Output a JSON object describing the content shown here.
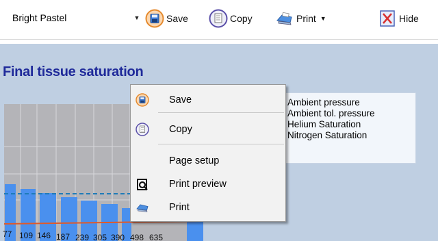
{
  "toolbar": {
    "theme_select": {
      "value": "Bright Pastel"
    },
    "save_label": "Save",
    "copy_label": "Copy",
    "print_label": "Print",
    "hide_label": "Hide"
  },
  "icons": {
    "combo_dropdown": "chevron-down-icon",
    "save": "floppy-disk-icon",
    "copy": "copy-document-icon",
    "print": "printer-icon",
    "print_dropdown": "chevron-down-icon",
    "hide": "hide-x-icon"
  },
  "chart": {
    "title": "Final tissue saturation",
    "legend": [
      "Ambient pressure",
      "Ambient tol. pressure",
      "Helium Saturation",
      "Nitrogen Saturation"
    ],
    "x_tick_labels": [
      "77",
      "109",
      "146",
      "187",
      "239",
      "305",
      "390",
      "498",
      "635"
    ]
  },
  "context_menu": {
    "items": [
      {
        "label": "Save",
        "icon": "floppy-disk-icon"
      },
      {
        "label": "Copy",
        "icon": "copy-document-icon"
      },
      {
        "label": "Page setup",
        "icon": ""
      },
      {
        "label": "Print preview",
        "icon": "print-preview-icon"
      },
      {
        "label": "Print",
        "icon": "printer-icon"
      }
    ]
  },
  "colors": {
    "chart_background": "#bfcfe2",
    "title": "#1f2a9a",
    "bar": "#4a90ee",
    "ambient_tol_line": "#1e7bb8",
    "nitrogen_line": "#e05a2a"
  }
}
